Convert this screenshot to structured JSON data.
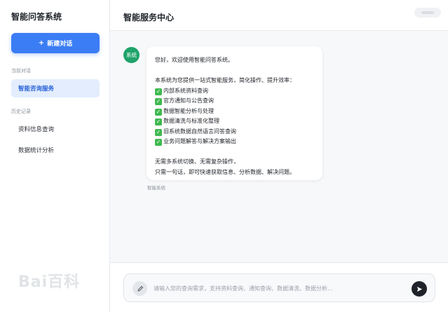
{
  "sidebar": {
    "app_title": "智能问答系统",
    "new_chat_label": "新建对话",
    "current_section_label": "当前对话",
    "current_item": "智能咨询服务",
    "history_section_label": "历史记录",
    "history_items": [
      "资料信息查询",
      "数据统计分析"
    ]
  },
  "header": {
    "title": "智能服务中心"
  },
  "message": {
    "avatar_label": "系统",
    "greeting": "您好，欢迎使用智能问答系统。",
    "intro": "本系统为您提供一站式智能服务，简化操作、提升效率：",
    "features": [
      "内部系统资料查询",
      "官方通知与公告查询",
      "数据智能分析与处理",
      "数据清洗与标准化整理",
      "旧系统数据自然语言问答查询",
      "业务问题解答与解决方案输出"
    ],
    "closing": [
      "无需多系统切换、无需复杂操作，",
      "只需一句话，即可快速获取信息、分析数据、解决问题。"
    ],
    "sender": "智能系统"
  },
  "input": {
    "placeholder": "请输入您的查询需求，支持资料查询、通知查询、数据清洗、数据分析...",
    "value": ""
  },
  "icons": {
    "mic": "microphone-icon",
    "send": "send-icon",
    "check": "check-icon",
    "plus": "plus-icon"
  },
  "watermark": {
    "text": "Bai百科"
  },
  "colors": {
    "accent": "#3b7df5",
    "avatar": "#1fa36a",
    "check": "#3fb950",
    "send": "#1f2329"
  }
}
